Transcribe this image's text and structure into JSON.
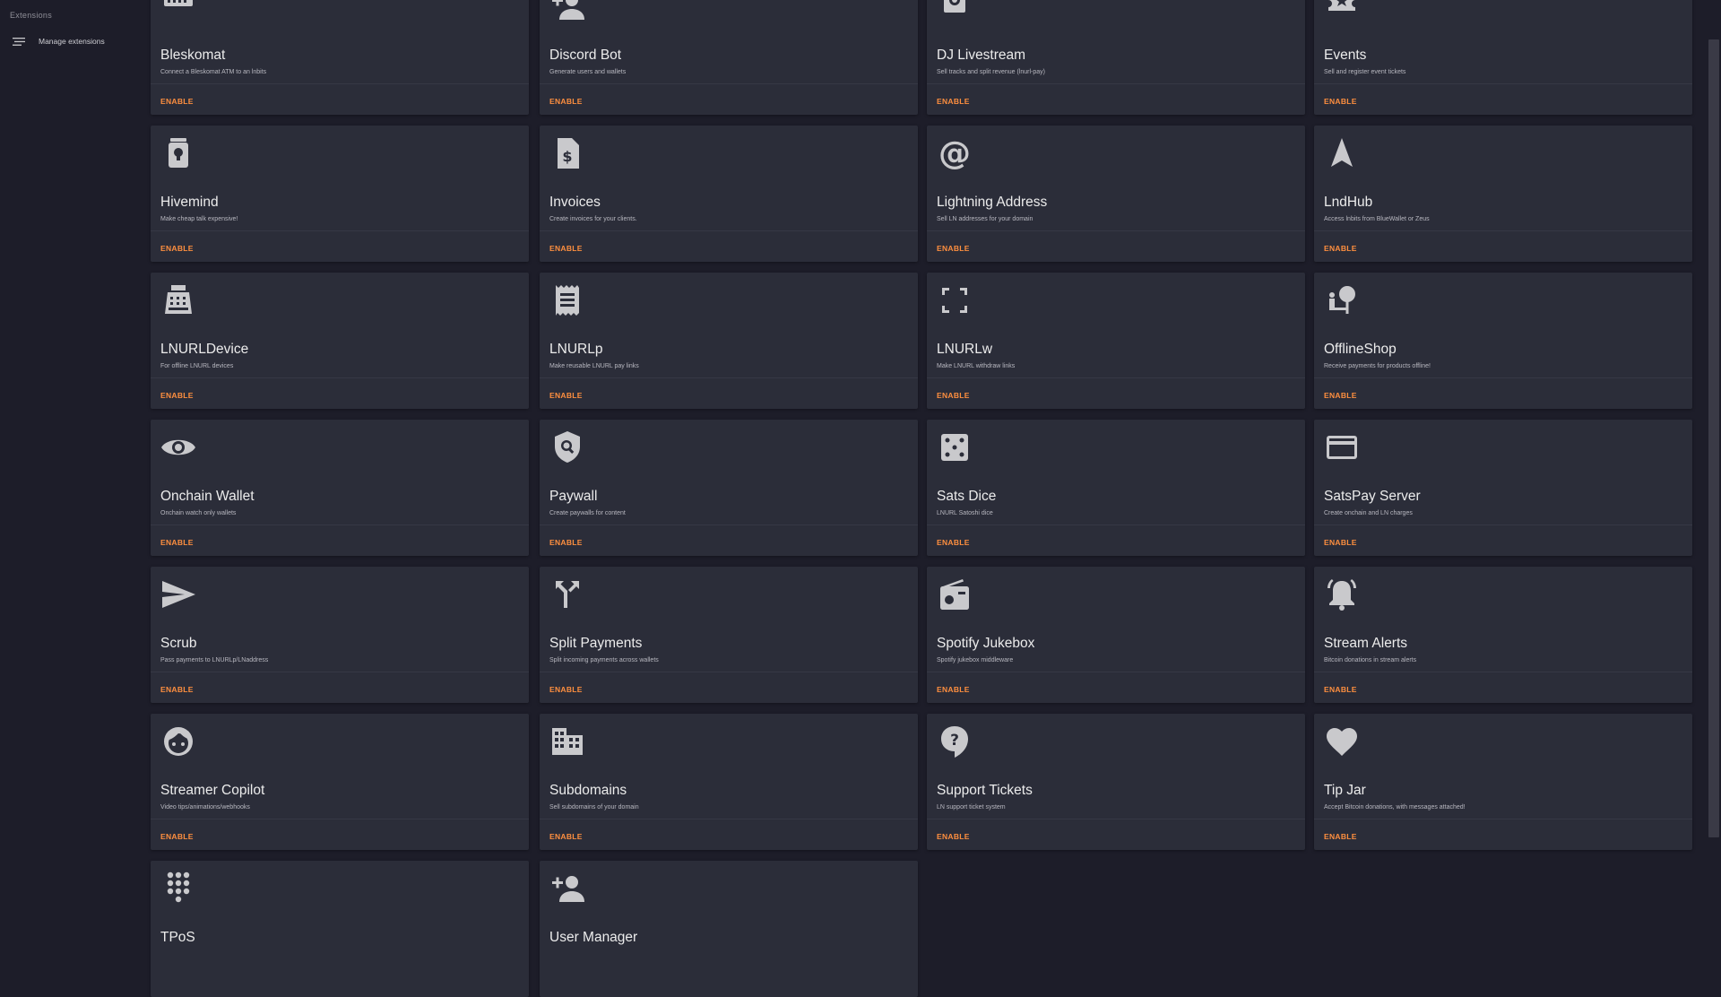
{
  "sidebar": {
    "title": "Extensions",
    "manage_label": "Manage extensions",
    "manage_icon": "sort-icon"
  },
  "colors": {
    "background": "#1d1d29",
    "card": "#2b2d39",
    "accent": "#ff8f3f",
    "icon": "#c9c9cc"
  },
  "extensions": [
    {
      "name": "Bleskomat",
      "description": "Connect a Bleskomat ATM to an lnbits",
      "action": "ENABLE",
      "icon": "atm-icon"
    },
    {
      "name": "Discord Bot",
      "description": "Generate users and wallets",
      "action": "ENABLE",
      "icon": "person-add-icon"
    },
    {
      "name": "DJ Livestream",
      "description": "Sell tracks and split revenue (lnurl-pay)",
      "action": "ENABLE",
      "icon": "speaker-icon"
    },
    {
      "name": "Events",
      "description": "Sell and register event tickets",
      "action": "ENABLE",
      "icon": "ticket-star-icon"
    },
    {
      "name": "Hivemind",
      "description": "Make cheap talk expensive!",
      "action": "ENABLE",
      "icon": "lightbulb-jar-icon"
    },
    {
      "name": "Invoices",
      "description": "Create invoices for your clients.",
      "action": "ENABLE",
      "icon": "request-quote-icon"
    },
    {
      "name": "Lightning Address",
      "description": "Sell LN addresses for your domain",
      "action": "ENABLE",
      "icon": "at-sign-icon"
    },
    {
      "name": "LndHub",
      "description": "Access lnbits from BlueWallet or Zeus",
      "action": "ENABLE",
      "icon": "navigation-arrow-icon"
    },
    {
      "name": "LNURLDevice",
      "description": "For offline LNURL devices",
      "action": "ENABLE",
      "icon": "point-of-sale-icon"
    },
    {
      "name": "LNURLp",
      "description": "Make reusable LNURL pay links",
      "action": "ENABLE",
      "icon": "receipt-icon"
    },
    {
      "name": "LNURLw",
      "description": "Make LNURL withdraw links",
      "action": "ENABLE",
      "icon": "crop-free-icon"
    },
    {
      "name": "OfflineShop",
      "description": "Receive payments for products offline!",
      "action": "ENABLE",
      "icon": "nature-people-icon"
    },
    {
      "name": "Onchain Wallet",
      "description": "Onchain watch only wallets",
      "action": "ENABLE",
      "icon": "eye-icon"
    },
    {
      "name": "Paywall",
      "description": "Create paywalls for content",
      "action": "ENABLE",
      "icon": "policy-shield-icon"
    },
    {
      "name": "Sats Dice",
      "description": "LNURL Satoshi dice",
      "action": "ENABLE",
      "icon": "dice-icon"
    },
    {
      "name": "SatsPay Server",
      "description": "Create onchain and LN charges",
      "action": "ENABLE",
      "icon": "credit-card-icon"
    },
    {
      "name": "Scrub",
      "description": "Pass payments to LNURLp/LNaddress",
      "action": "ENABLE",
      "icon": "send-icon"
    },
    {
      "name": "Split Payments",
      "description": "Split incoming payments across wallets",
      "action": "ENABLE",
      "icon": "call-split-icon"
    },
    {
      "name": "Spotify Jukebox",
      "description": "Spotify jukebox middleware",
      "action": "ENABLE",
      "icon": "radio-icon"
    },
    {
      "name": "Stream Alerts",
      "description": "Bitcoin donations in stream alerts",
      "action": "ENABLE",
      "icon": "bell-alert-icon"
    },
    {
      "name": "Streamer Copilot",
      "description": "Video tips/animations/webhooks",
      "action": "ENABLE",
      "icon": "face-icon"
    },
    {
      "name": "Subdomains",
      "description": "Sell subdomains of your domain",
      "action": "ENABLE",
      "icon": "domain-icon"
    },
    {
      "name": "Support Tickets",
      "description": "LN support ticket system",
      "action": "ENABLE",
      "icon": "help-bubble-icon"
    },
    {
      "name": "Tip Jar",
      "description": "Accept Bitcoin donations, with messages attached!",
      "action": "ENABLE",
      "icon": "heart-icon"
    },
    {
      "name": "TPoS",
      "description": "",
      "action": "",
      "icon": "dialpad-icon"
    },
    {
      "name": "User Manager",
      "description": "",
      "action": "",
      "icon": "person-add-icon"
    }
  ]
}
